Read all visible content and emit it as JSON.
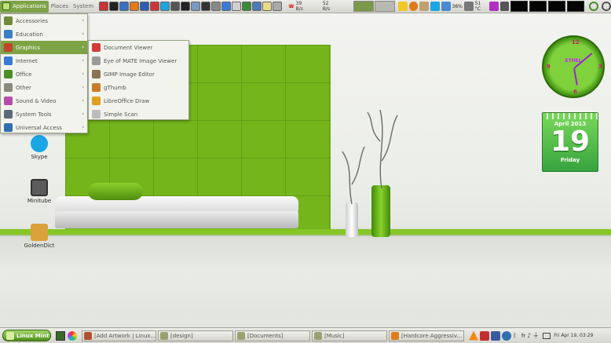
{
  "top_panel": {
    "menus": [
      "Applications",
      "Places",
      "System"
    ],
    "net_down": "39 B/s",
    "net_up": "52 B/s",
    "battery": "36%",
    "temperature": "51 °C"
  },
  "applications_menu": {
    "categories": [
      {
        "label": "Accessories",
        "color": "#6f8a3b"
      },
      {
        "label": "Education",
        "color": "#3d7fc4"
      },
      {
        "label": "Graphics",
        "color": "#c0452a"
      },
      {
        "label": "Internet",
        "color": "#3a79d4"
      },
      {
        "label": "Office",
        "color": "#4b8f29"
      },
      {
        "label": "Other",
        "color": "#8a8a7c"
      },
      {
        "label": "Sound & Video",
        "color": "#b54ea8"
      },
      {
        "label": "System Tools",
        "color": "#5d6a7b"
      },
      {
        "label": "Universal Access",
        "color": "#2f6fb0"
      }
    ],
    "selected_index": 2
  },
  "graphics_submenu": {
    "items": [
      {
        "label": "Document Viewer",
        "color": "#d23a3a"
      },
      {
        "label": "Eye of MATE Image Viewer",
        "color": "#9a9a9a"
      },
      {
        "label": "GIMP Image Editor",
        "color": "#8a7452"
      },
      {
        "label": "gThumb",
        "color": "#c97b2a"
      },
      {
        "label": "LibreOffice Draw",
        "color": "#e0a020"
      },
      {
        "label": "Simple Scan",
        "color": "#bdbdbd"
      }
    ]
  },
  "desktop_icons": [
    {
      "label": "Skype",
      "color": "#1aa6e4"
    },
    {
      "label": "Minitube",
      "color": "#5b5b5b"
    },
    {
      "label": "GoldenDict",
      "color": "#d9a23a"
    }
  ],
  "clock_widget": {
    "brand": "ETHEL"
  },
  "calendar_widget": {
    "month_year": "April 2013",
    "day": "19",
    "weekday": "Friday"
  },
  "bottom_panel": {
    "menu_button": "Linux Mint",
    "tasks": [
      "[Add Artwork | Linux...",
      "[design]",
      "[Documents]",
      "[Music]",
      "[Hardcore Aggressiv..."
    ],
    "keyboard_layout": "fr",
    "clock": "Fri Apr 19, 03:29"
  }
}
